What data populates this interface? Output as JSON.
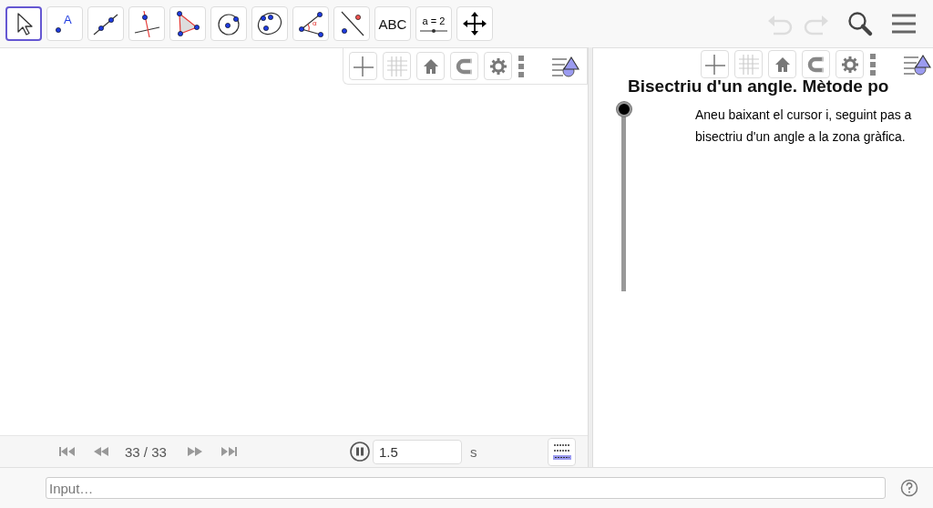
{
  "toolbar": {
    "tools": [
      {
        "kind": "move",
        "selected": true
      },
      {
        "kind": "point",
        "label": "A",
        "selected": false
      },
      {
        "kind": "line",
        "selected": false
      },
      {
        "kind": "perpendicular",
        "selected": false
      },
      {
        "kind": "polygon",
        "selected": false
      },
      {
        "kind": "circle",
        "selected": false
      },
      {
        "kind": "conic",
        "selected": false
      },
      {
        "kind": "angle",
        "label": "α",
        "selected": false
      },
      {
        "kind": "reflect",
        "selected": false
      },
      {
        "kind": "text",
        "label": "ABC",
        "selected": false
      },
      {
        "kind": "slider",
        "label": "a = 2",
        "selected": false
      },
      {
        "kind": "pan",
        "selected": false
      }
    ],
    "undo": {
      "disabled": true
    },
    "redo": {
      "disabled": true
    }
  },
  "graphics_view": {
    "animation": {
      "step": "33 / 33",
      "playing": true,
      "speed": "1.5",
      "unit": "s"
    }
  },
  "text_view": {
    "title": "Bisectriu d'un angle. Mètode po",
    "slider": {
      "level": 1
    },
    "paragraph_lines": [
      "Aneu baixant el cursor i, seguint pas a",
      "bisectriu d'un angle a la zona gràfica."
    ]
  },
  "input_bar": {
    "placeholder": "Input…"
  }
}
